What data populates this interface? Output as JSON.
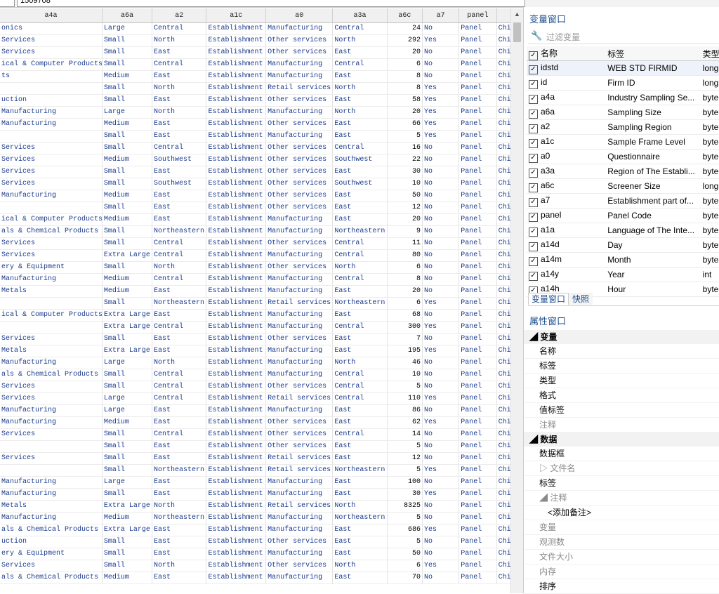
{
  "top": {
    "value_box": "1509708"
  },
  "grid": {
    "columns": [
      "a4a",
      "a6a",
      "a2",
      "a1c",
      "a0",
      "a3a",
      "a6c",
      "a7",
      "panel",
      ""
    ],
    "rows": [
      [
        "onics",
        "Large",
        "Central",
        "Establishment",
        "Manufacturing",
        "Central",
        "24",
        "No",
        "Panel",
        "Chir"
      ],
      [
        "Services",
        "Small",
        "North",
        "Establishment",
        "Other services",
        "North",
        "292",
        "Yes",
        "Panel",
        "Chir"
      ],
      [
        "Services",
        "Small",
        "East",
        "Establishment",
        "Other services",
        "East",
        "20",
        "No",
        "Panel",
        "Chir"
      ],
      [
        "ical & Computer Products",
        "Small",
        "Central",
        "Establishment",
        "Manufacturing",
        "Central",
        "6",
        "No",
        "Panel",
        "Chir"
      ],
      [
        "ts",
        "Medium",
        "East",
        "Establishment",
        "Manufacturing",
        "East",
        "8",
        "No",
        "Panel",
        "Chir"
      ],
      [
        "",
        "Small",
        "North",
        "Establishment",
        "Retail services",
        "North",
        "8",
        "Yes",
        "Panel",
        "Chir"
      ],
      [
        "uction",
        "Small",
        "East",
        "Establishment",
        "Other services",
        "East",
        "58",
        "Yes",
        "Panel",
        "Chir"
      ],
      [
        "Manufacturing",
        "Large",
        "North",
        "Establishment",
        "Manufacturing",
        "North",
        "20",
        "Yes",
        "Panel",
        "Chir"
      ],
      [
        "Manufacturing",
        "Medium",
        "East",
        "Establishment",
        "Other services",
        "East",
        "66",
        "Yes",
        "Panel",
        "Chir"
      ],
      [
        "",
        "Small",
        "East",
        "Establishment",
        "Manufacturing",
        "East",
        "5",
        "Yes",
        "Panel",
        "Chir"
      ],
      [
        "Services",
        "Small",
        "Central",
        "Establishment",
        "Other services",
        "Central",
        "16",
        "No",
        "Panel",
        "Chir"
      ],
      [
        "Services",
        "Medium",
        "Southwest",
        "Establishment",
        "Other services",
        "Southwest",
        "22",
        "No",
        "Panel",
        "Chir"
      ],
      [
        "Services",
        "Small",
        "East",
        "Establishment",
        "Other services",
        "East",
        "30",
        "No",
        "Panel",
        "Chir"
      ],
      [
        "Services",
        "Small",
        "Southwest",
        "Establishment",
        "Other services",
        "Southwest",
        "10",
        "No",
        "Panel",
        "Chir"
      ],
      [
        "Manufacturing",
        "Medium",
        "East",
        "Establishment",
        "Other services",
        "East",
        "50",
        "No",
        "Panel",
        "Chir"
      ],
      [
        "",
        "Small",
        "East",
        "Establishment",
        "Other services",
        "East",
        "12",
        "No",
        "Panel",
        "Chir"
      ],
      [
        "ical & Computer Products",
        "Medium",
        "East",
        "Establishment",
        "Manufacturing",
        "East",
        "20",
        "No",
        "Panel",
        "Chir"
      ],
      [
        "als & Chemical Products",
        "Small",
        "Northeastern",
        "Establishment",
        "Manufacturing",
        "Northeastern",
        "9",
        "No",
        "Panel",
        "Chir"
      ],
      [
        "Services",
        "Small",
        "Central",
        "Establishment",
        "Other services",
        "Central",
        "11",
        "No",
        "Panel",
        "Chir"
      ],
      [
        "Services",
        "Extra Large",
        "Central",
        "Establishment",
        "Manufacturing",
        "Central",
        "80",
        "No",
        "Panel",
        "Chir"
      ],
      [
        "ery & Equipment",
        "Small",
        "North",
        "Establishment",
        "Other services",
        "North",
        "6",
        "No",
        "Panel",
        "Chir"
      ],
      [
        "Manufacturing",
        "Medium",
        "Central",
        "Establishment",
        "Manufacturing",
        "Central",
        "8",
        "No",
        "Panel",
        "Chir"
      ],
      [
        "Metals",
        "Medium",
        "East",
        "Establishment",
        "Manufacturing",
        "East",
        "20",
        "No",
        "Panel",
        "Chir"
      ],
      [
        "",
        "Small",
        "Northeastern",
        "Establishment",
        "Retail services",
        "Northeastern",
        "6",
        "Yes",
        "Panel",
        "Chir"
      ],
      [
        "ical & Computer Products",
        "Extra Large",
        "East",
        "Establishment",
        "Manufacturing",
        "East",
        "68",
        "No",
        "Panel",
        "Chir"
      ],
      [
        "",
        "Extra Large",
        "Central",
        "Establishment",
        "Manufacturing",
        "Central",
        "300",
        "Yes",
        "Panel",
        "Chir"
      ],
      [
        "Services",
        "Small",
        "East",
        "Establishment",
        "Other services",
        "East",
        "7",
        "No",
        "Panel",
        "Chir"
      ],
      [
        "Metals",
        "Extra Large",
        "East",
        "Establishment",
        "Manufacturing",
        "East",
        "195",
        "Yes",
        "Panel",
        "Chir"
      ],
      [
        "Manufacturing",
        "Large",
        "North",
        "Establishment",
        "Manufacturing",
        "North",
        "46",
        "No",
        "Panel",
        "Chir"
      ],
      [
        "als & Chemical Products",
        "Small",
        "Central",
        "Establishment",
        "Manufacturing",
        "Central",
        "10",
        "No",
        "Panel",
        "Chir"
      ],
      [
        "Services",
        "Small",
        "Central",
        "Establishment",
        "Other services",
        "Central",
        "5",
        "No",
        "Panel",
        "Chir"
      ],
      [
        "Services",
        "Large",
        "Central",
        "Establishment",
        "Retail services",
        "Central",
        "110",
        "Yes",
        "Panel",
        "Chir"
      ],
      [
        "Manufacturing",
        "Large",
        "East",
        "Establishment",
        "Manufacturing",
        "East",
        "86",
        "No",
        "Panel",
        "Chir"
      ],
      [
        "Manufacturing",
        "Medium",
        "East",
        "Establishment",
        "Other services",
        "East",
        "62",
        "Yes",
        "Panel",
        "Chir"
      ],
      [
        "Services",
        "Small",
        "Central",
        "Establishment",
        "Other services",
        "Central",
        "14",
        "No",
        "Panel",
        "Chir"
      ],
      [
        "",
        "Small",
        "East",
        "Establishment",
        "Other services",
        "East",
        "5",
        "No",
        "Panel",
        "Chir"
      ],
      [
        "Services",
        "Small",
        "East",
        "Establishment",
        "Retail services",
        "East",
        "12",
        "No",
        "Panel",
        "Chir"
      ],
      [
        "",
        "Small",
        "Northeastern",
        "Establishment",
        "Retail services",
        "Northeastern",
        "5",
        "Yes",
        "Panel",
        "Chir"
      ],
      [
        "Manufacturing",
        "Large",
        "East",
        "Establishment",
        "Manufacturing",
        "East",
        "100",
        "No",
        "Panel",
        "Chir"
      ],
      [
        "Manufacturing",
        "Small",
        "East",
        "Establishment",
        "Manufacturing",
        "East",
        "30",
        "Yes",
        "Panel",
        "Chir"
      ],
      [
        "Metals",
        "Extra Large",
        "North",
        "Establishment",
        "Retail services",
        "North",
        "8325",
        "No",
        "Panel",
        "Chir"
      ],
      [
        "Manufacturing",
        "Medium",
        "Northeastern",
        "Establishment",
        "Manufacturing",
        "Northeastern",
        "5",
        "No",
        "Panel",
        "Chir"
      ],
      [
        "als & Chemical Products",
        "Extra Large",
        "East",
        "Establishment",
        "Manufacturing",
        "East",
        "686",
        "Yes",
        "Panel",
        "Chir"
      ],
      [
        "uction",
        "Small",
        "East",
        "Establishment",
        "Other services",
        "East",
        "5",
        "No",
        "Panel",
        "Chir"
      ],
      [
        "ery & Equipment",
        "Small",
        "East",
        "Establishment",
        "Manufacturing",
        "East",
        "50",
        "No",
        "Panel",
        "Chir"
      ],
      [
        "Services",
        "Small",
        "North",
        "Establishment",
        "Other services",
        "North",
        "6",
        "Yes",
        "Panel",
        "Chir"
      ],
      [
        "als & Chemical Products",
        "Medium",
        "East",
        "Establishment",
        "Manufacturing",
        "East",
        "70",
        "No",
        "Panel",
        "Chir"
      ]
    ]
  },
  "var_window": {
    "title": "变量窗口",
    "filter_placeholder": "过滤变量",
    "headers": {
      "name": "名称",
      "label": "标签",
      "type": "类型"
    },
    "variables": [
      {
        "name": "idstd",
        "label": "WEB STD FIRMID",
        "type": "long"
      },
      {
        "name": "id",
        "label": "Firm ID",
        "type": "long"
      },
      {
        "name": "a4a",
        "label": "Industry Sampling Se...",
        "type": "byte"
      },
      {
        "name": "a6a",
        "label": "Sampling Size",
        "type": "byte"
      },
      {
        "name": "a2",
        "label": "Sampling Region",
        "type": "byte"
      },
      {
        "name": "a1c",
        "label": "Sample Frame Level",
        "type": "byte"
      },
      {
        "name": "a0",
        "label": "Questionnaire",
        "type": "byte"
      },
      {
        "name": "a3a",
        "label": "Region of The Establi...",
        "type": "byte"
      },
      {
        "name": "a6c",
        "label": "Screener Size",
        "type": "long"
      },
      {
        "name": "a7",
        "label": "Establishment part of...",
        "type": "byte"
      },
      {
        "name": "panel",
        "label": "Panel Code",
        "type": "byte"
      },
      {
        "name": "a1a",
        "label": "Language of The Inte...",
        "type": "byte"
      },
      {
        "name": "a14d",
        "label": "Day",
        "type": "byte"
      },
      {
        "name": "a14m",
        "label": "Month",
        "type": "byte"
      },
      {
        "name": "a14y",
        "label": "Year",
        "type": "int"
      },
      {
        "name": "a14h",
        "label": "Hour",
        "type": "byte"
      }
    ],
    "tabs": [
      "变量窗口",
      "快照"
    ]
  },
  "prop_window": {
    "title": "属性窗口",
    "sections": [
      {
        "label": "◢ 变量",
        "items": [
          "名称",
          "标签",
          "类型",
          "格式",
          "值标签",
          "注释"
        ]
      },
      {
        "label": "◢ 数据",
        "items": [
          "数据框",
          "▷ 文件名",
          "标签",
          "◢ 注释",
          "<添加备注>",
          "变量",
          "观测数",
          "文件大小",
          "内存",
          "排序"
        ]
      }
    ]
  }
}
